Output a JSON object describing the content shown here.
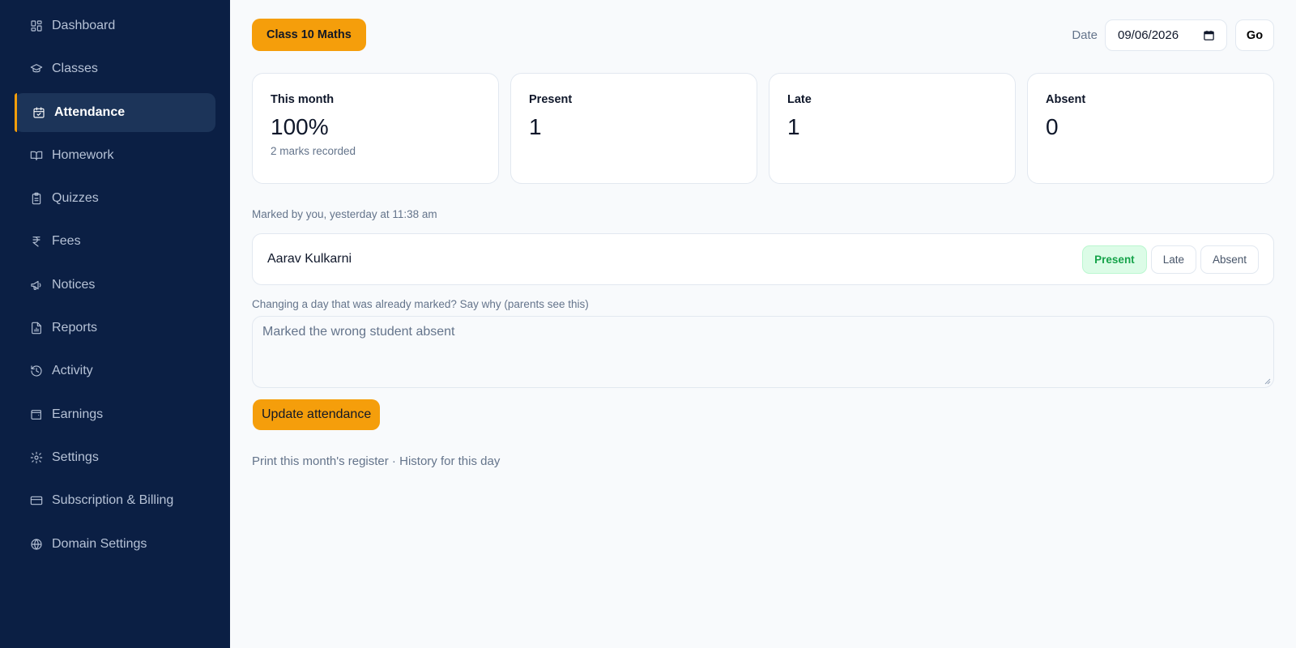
{
  "sidebar": {
    "items": [
      {
        "label": "Dashboard",
        "icon": "dashboard-icon",
        "active": false
      },
      {
        "label": "Classes",
        "icon": "graduation-cap-icon",
        "active": false
      },
      {
        "label": "Attendance",
        "icon": "calendar-check-icon",
        "active": true
      },
      {
        "label": "Homework",
        "icon": "book-open-icon",
        "active": false
      },
      {
        "label": "Quizzes",
        "icon": "clipboard-icon",
        "active": false
      },
      {
        "label": "Fees",
        "icon": "rupee-icon",
        "active": false
      },
      {
        "label": "Notices",
        "icon": "megaphone-icon",
        "active": false
      },
      {
        "label": "Reports",
        "icon": "file-chart-icon",
        "active": false
      },
      {
        "label": "Activity",
        "icon": "history-icon",
        "active": false
      },
      {
        "label": "Earnings",
        "icon": "wallet-icon",
        "active": false
      },
      {
        "label": "Settings",
        "icon": "gear-icon",
        "active": false
      },
      {
        "label": "Subscription & Billing",
        "icon": "credit-card-icon",
        "active": false
      },
      {
        "label": "Domain Settings",
        "icon": "globe-icon",
        "active": false
      }
    ]
  },
  "header": {
    "class_label": "Class 10 Maths",
    "date_label": "Date",
    "date_value": "09/06/2026",
    "go_label": "Go"
  },
  "stats": [
    {
      "title": "This month",
      "value": "100%",
      "sub": "2 marks recorded"
    },
    {
      "title": "Present",
      "value": "1",
      "sub": ""
    },
    {
      "title": "Late",
      "value": "1",
      "sub": ""
    },
    {
      "title": "Absent",
      "value": "0",
      "sub": ""
    }
  ],
  "marked_by": "Marked by you, yesterday at 11:38 am",
  "student": {
    "name": "Aarav Kulkarni",
    "options": [
      "Present",
      "Late",
      "Absent"
    ],
    "selected": "Present"
  },
  "reason": {
    "label": "Changing a day that was already marked? Say why (parents see this)",
    "value": "Marked the wrong student absent"
  },
  "update_label": "Update attendance",
  "footer": {
    "print_link": "Print this month's register",
    "separator": " · ",
    "history_link": "History for this day"
  },
  "colors": {
    "sidebar_bg": "#0b1f44",
    "accent": "#f59e0b",
    "present_bg": "#dcfce7",
    "present_text": "#16a34a"
  }
}
